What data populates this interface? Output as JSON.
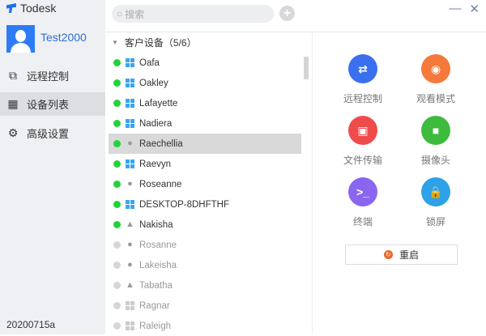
{
  "app": {
    "title": "Todesk",
    "minimize": "—",
    "close": "✕"
  },
  "user": {
    "name": "Test2000"
  },
  "nav": [
    {
      "label": "远程控制",
      "icon": "remote-screen-icon"
    },
    {
      "label": "设备列表",
      "icon": "grid-icon"
    },
    {
      "label": "高级设置",
      "icon": "gear-icon"
    }
  ],
  "version": "20200715a",
  "search": {
    "placeholder": "搜索",
    "add": "+"
  },
  "group": {
    "label": "客户设备（5/6）"
  },
  "devices": [
    {
      "name": "Oafa",
      "os": "windows",
      "online": true
    },
    {
      "name": "Oakley",
      "os": "windows",
      "online": true
    },
    {
      "name": "Lafayette",
      "os": "windows",
      "online": true
    },
    {
      "name": "Nadiera",
      "os": "windows",
      "online": true
    },
    {
      "name": "Raechellia",
      "os": "apple",
      "online": true,
      "selected": true
    },
    {
      "name": "Raevyn",
      "os": "windows",
      "online": true
    },
    {
      "name": "Roseanne",
      "os": "apple",
      "online": true
    },
    {
      "name": "DESKTOP-8DHFTHF",
      "os": "windows",
      "online": true
    },
    {
      "name": "Nakisha",
      "os": "linux",
      "online": true
    },
    {
      "name": "Rosanne",
      "os": "apple",
      "online": false
    },
    {
      "name": "Lakeisha",
      "os": "apple",
      "online": false
    },
    {
      "name": "Tabatha",
      "os": "linux",
      "online": false
    },
    {
      "name": "Ragnar",
      "os": "windows",
      "online": false
    },
    {
      "name": "Raleigh",
      "os": "windows",
      "online": false
    }
  ],
  "actions": [
    {
      "label": "远程控制",
      "glyph": "⇄",
      "color": "#3a6ff0",
      "name": "remote-control"
    },
    {
      "label": "观看模式",
      "glyph": "◉",
      "color": "#f4793a",
      "name": "view-mode"
    },
    {
      "label": "文件传输",
      "glyph": "▣",
      "color": "#ef4b4b",
      "name": "file-transfer"
    },
    {
      "label": "摄像头",
      "glyph": "■",
      "color": "#3dbb3d",
      "name": "camera"
    },
    {
      "label": "终端",
      "glyph": ">_",
      "color": "#8a66f0",
      "name": "terminal"
    },
    {
      "label": "锁屏",
      "glyph": "🔒",
      "color": "#2ea1e8",
      "name": "lock-screen"
    }
  ],
  "restart": {
    "label": "重启"
  }
}
